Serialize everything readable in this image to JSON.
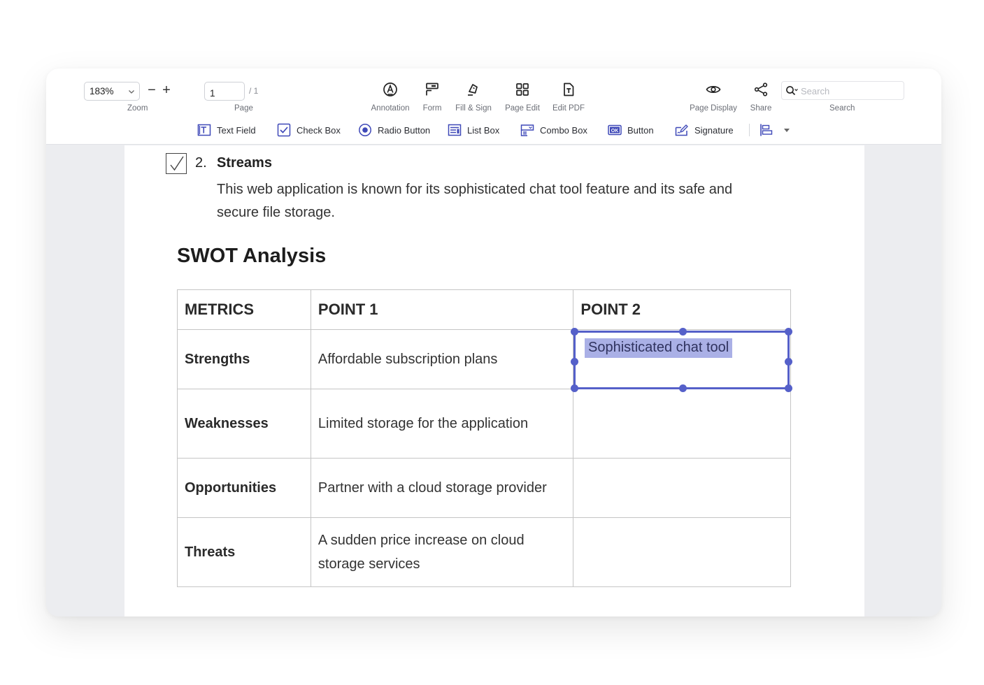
{
  "toolbar": {
    "zoom": {
      "value": "183%",
      "label": "Zoom"
    },
    "page": {
      "value": "1",
      "total": "/ 1",
      "label": "Page"
    },
    "tools": [
      {
        "icon": "annotation-icon",
        "label": "Annotation"
      },
      {
        "icon": "form-icon",
        "label": "Form"
      },
      {
        "icon": "fill-sign-icon",
        "label": "Fill & Sign"
      },
      {
        "icon": "page-edit-icon",
        "label": "Page Edit"
      },
      {
        "icon": "edit-pdf-icon",
        "label": "Edit PDF"
      },
      {
        "icon": "page-display-icon",
        "label": "Page Display"
      },
      {
        "icon": "share-icon",
        "label": "Share"
      }
    ],
    "search": {
      "placeholder": "Search",
      "label": "Search"
    }
  },
  "form_tools": [
    {
      "icon": "text-field-icon",
      "label": "Text Field"
    },
    {
      "icon": "check-box-icon",
      "label": "Check Box"
    },
    {
      "icon": "radio-button-icon",
      "label": "Radio Button"
    },
    {
      "icon": "list-box-icon",
      "label": "List Box"
    },
    {
      "icon": "combo-box-icon",
      "label": "Combo Box"
    },
    {
      "icon": "button-icon",
      "label": "Button"
    },
    {
      "icon": "signature-icon",
      "label": "Signature"
    },
    {
      "icon": "align-icon",
      "label": ""
    }
  ],
  "colors": {
    "accent": "#5560c9",
    "selection_highlight": "#aab0e6"
  },
  "document": {
    "item": {
      "checked": true,
      "number": "2.",
      "title": "Streams",
      "description": "This web application is known for its sophisticated chat tool feature and its safe and secure file storage."
    },
    "swot_title": "SWOT Analysis",
    "table": {
      "headers": [
        "METRICS",
        "POINT 1",
        "POINT 2"
      ],
      "rows": [
        {
          "metric": "Strengths",
          "point1": "Affordable subscription plans",
          "point2": ""
        },
        {
          "metric": "Weaknesses",
          "point1": "Limited storage for the application",
          "point2": ""
        },
        {
          "metric": "Opportunities",
          "point1": "Partner with a cloud storage provider",
          "point2": ""
        },
        {
          "metric": "Threats",
          "point1": "A sudden price increase on cloud storage services",
          "point2": ""
        }
      ]
    },
    "selected_field": {
      "text": "Sophisticated chat tool"
    }
  }
}
